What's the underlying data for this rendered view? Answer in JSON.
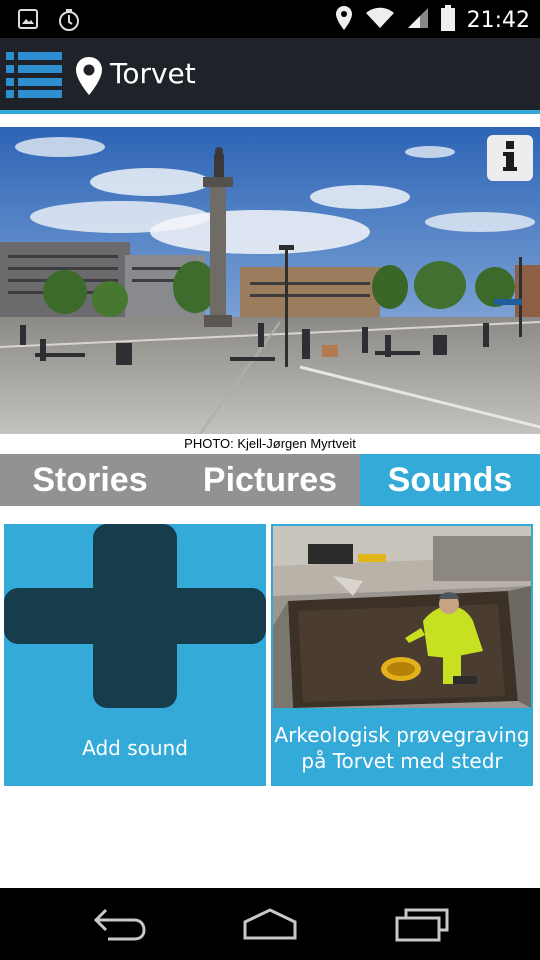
{
  "status_bar": {
    "time": "21:42",
    "icons": [
      "image-notification-icon",
      "sync-notification-icon",
      "location-icon",
      "wifi-icon",
      "signal-icon",
      "battery-icon"
    ]
  },
  "app_bar": {
    "title": "Torvet",
    "menu_icon": "list-menu-icon",
    "place_icon": "location-pin-icon"
  },
  "hero": {
    "photo_credit": "PHOTO: Kjell-Jørgen Myrtveit",
    "info_icon": "info-icon"
  },
  "tabs": [
    {
      "label": "Stories",
      "active": false
    },
    {
      "label": "Pictures",
      "active": false
    },
    {
      "label": "Sounds",
      "active": true
    }
  ],
  "tiles": {
    "add_label": "Add sound",
    "sound_title_line1": "Arkeologisk prøvegraving",
    "sound_title_line2": "på Torvet med stedr"
  },
  "nav_bar": {
    "icons": [
      "back-icon",
      "home-icon",
      "recent-apps-icon"
    ]
  },
  "colors": {
    "accent": "#33aad8",
    "appbar": "#202229",
    "tab_inactive": "#929292",
    "plus": "#173d4d"
  }
}
